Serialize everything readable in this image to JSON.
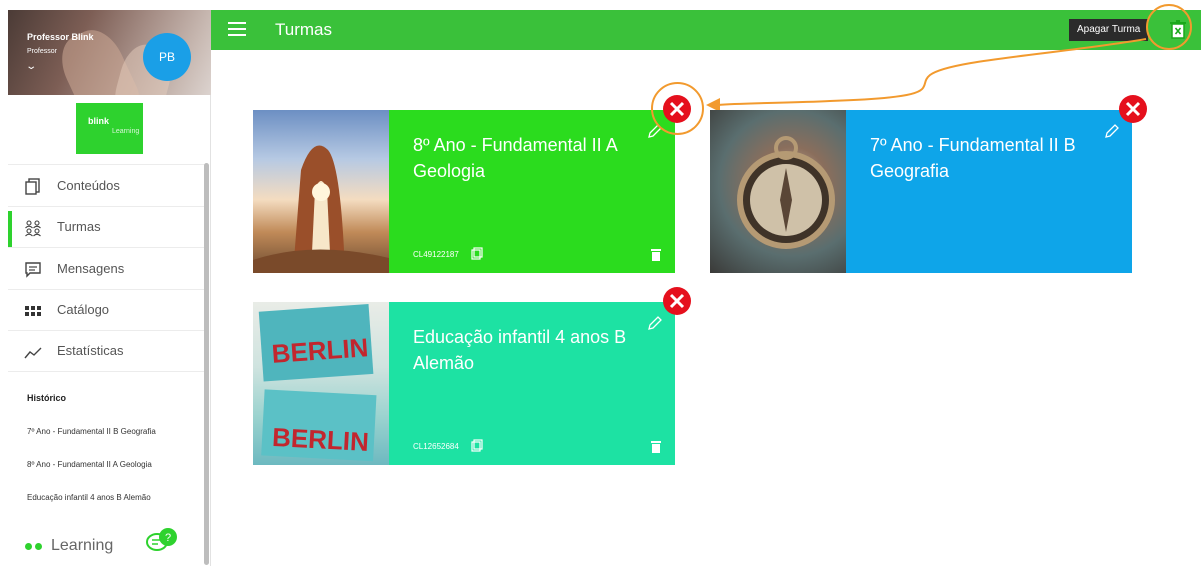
{
  "sidebar": {
    "user_name": "Professor Blink",
    "user_role": "Professor",
    "avatar_initials": "PB",
    "brand_primary": "blink",
    "brand_secondary": "Learning",
    "nav": [
      {
        "label": "Conteúdos",
        "icon": "copy-icon",
        "active": false
      },
      {
        "label": "Turmas",
        "icon": "people-icon",
        "active": true
      },
      {
        "label": "Mensagens",
        "icon": "message-icon",
        "active": false
      },
      {
        "label": "Catálogo",
        "icon": "grid-icon",
        "active": false
      },
      {
        "label": "Estatísticas",
        "icon": "chart-icon",
        "active": false
      }
    ],
    "history_title": "Histórico",
    "history": [
      "7º Ano - Fundamental II B Geografia",
      "8º Ano - Fundamental II A Geologia",
      "Educação infantil 4 anos B Alemão"
    ],
    "footer_brand": "Learning",
    "help_icon": "chat-help-icon"
  },
  "topbar": {
    "title": "Turmas",
    "tooltip": "Apagar Turma",
    "delete_icon": "trash-icon"
  },
  "cards": [
    {
      "title": "8º Ano - Fundamental II A Geologia",
      "code": "CL49122187",
      "color": "#2bdc1e",
      "image": "rock-arch-photo"
    },
    {
      "title": "7º Ano - Fundamental II B Geografia",
      "code": "",
      "color": "#0ea5e9",
      "image": "compass-photo"
    },
    {
      "title": "Educação infantil 4 anos B Alemão",
      "code": "CL12652684",
      "color": "#1de2a3",
      "image": "berlin-postcards-photo"
    }
  ],
  "colors": {
    "accent": "#3ac13a",
    "danger": "#e5101d",
    "highlight": "#f29a2e",
    "tooltip_bg": "#2b2b2b"
  }
}
